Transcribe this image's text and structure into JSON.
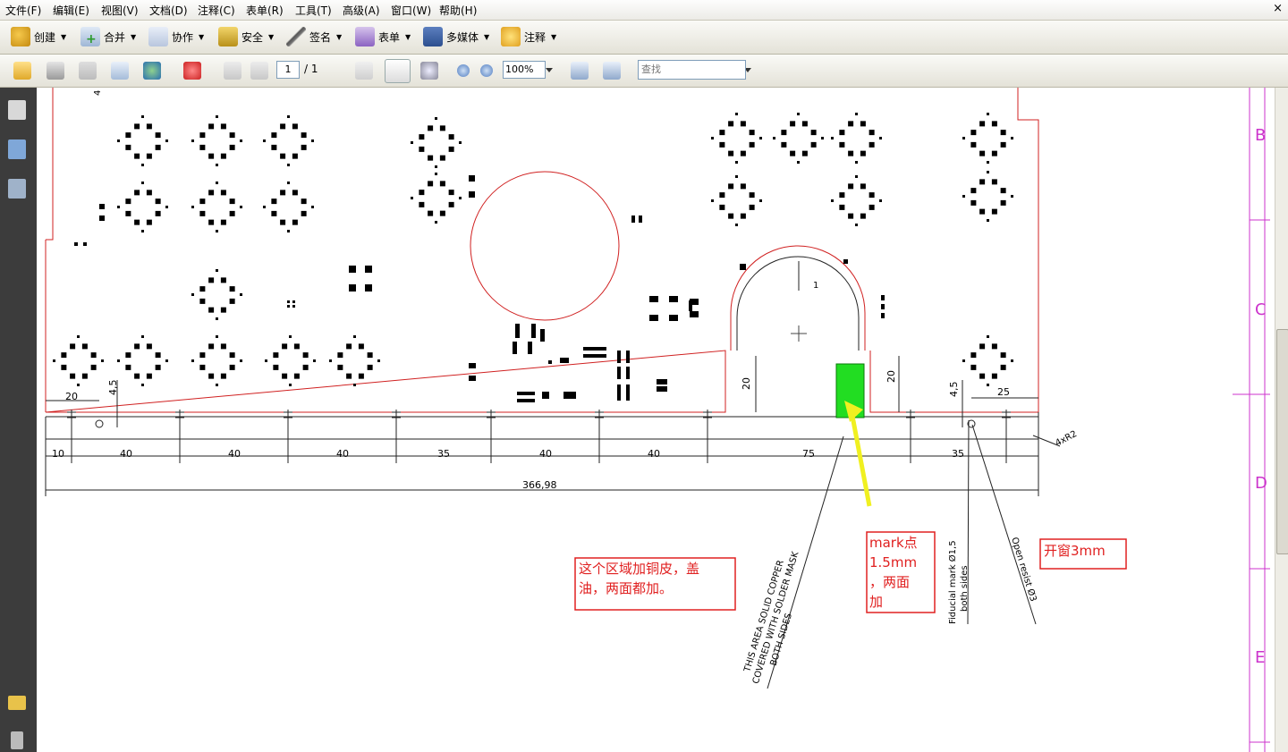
{
  "menu": [
    "文件(F)",
    "编辑(E)",
    "视图(V)",
    "文档(D)",
    "注释(C)",
    "表单(R)",
    "工具(T)",
    "高级(A)",
    "窗口(W)",
    "帮助(H)"
  ],
  "menu_close": "×",
  "toolbar1": [
    {
      "label": "创建",
      "icon": "create-icon"
    },
    {
      "label": "合并",
      "icon": "combine-icon"
    },
    {
      "label": "协作",
      "icon": "collaborate-icon"
    },
    {
      "label": "安全",
      "icon": "lock-icon"
    },
    {
      "label": "签名",
      "icon": "pen-icon"
    },
    {
      "label": "表单",
      "icon": "form-icon"
    },
    {
      "label": "多媒体",
      "icon": "multimedia-icon"
    },
    {
      "label": "注释",
      "icon": "comment-icon"
    }
  ],
  "toolbar2": {
    "page_current": "1",
    "page_total": "/ 1",
    "zoom": "100%",
    "find_placeholder": "查找"
  },
  "drawing": {
    "dims": {
      "d20_left": "20",
      "d4_5_left": "4,5",
      "d10": "10",
      "d40a": "40",
      "d40b": "40",
      "d40c": "40",
      "d35a": "35",
      "d40d": "40",
      "d40e": "40",
      "d75": "75",
      "d35b": "35",
      "total": "366,98",
      "d25": "25",
      "d4_5_right": "4,5",
      "d20_slot_left": "20",
      "d20_slot_right": "20",
      "d1": "1",
      "d4": "4",
      "r2": "4xR2"
    },
    "notes": {
      "copper_line1": "THIS AREA SOLID COPPER",
      "copper_line2": "COVERED WITH SOLDER MASK",
      "copper_line3": "BOTH SIDES",
      "fiducial_line1": "Fiducial mark Ø1,5",
      "fiducial_line2": "both sides",
      "open_resist": "Open resist Ø3"
    },
    "frame_labels": [
      "B",
      "C",
      "D",
      "E"
    ]
  },
  "annotations": {
    "copper_cn": [
      "这个区域加铜皮，盖",
      "油，两面都加。"
    ],
    "mark_cn": [
      "mark点",
      "1.5mm",
      "，两面",
      "加"
    ],
    "window_cn": "开窗3mm"
  },
  "colors": {
    "outline_red": "#d02020",
    "annotation_red": "#e02020",
    "arrow_yellow": "#f0f020",
    "mark_green": "#22dd22",
    "frame_magenta": "#cc33cc",
    "panel_dark": "#3c3c3c"
  }
}
